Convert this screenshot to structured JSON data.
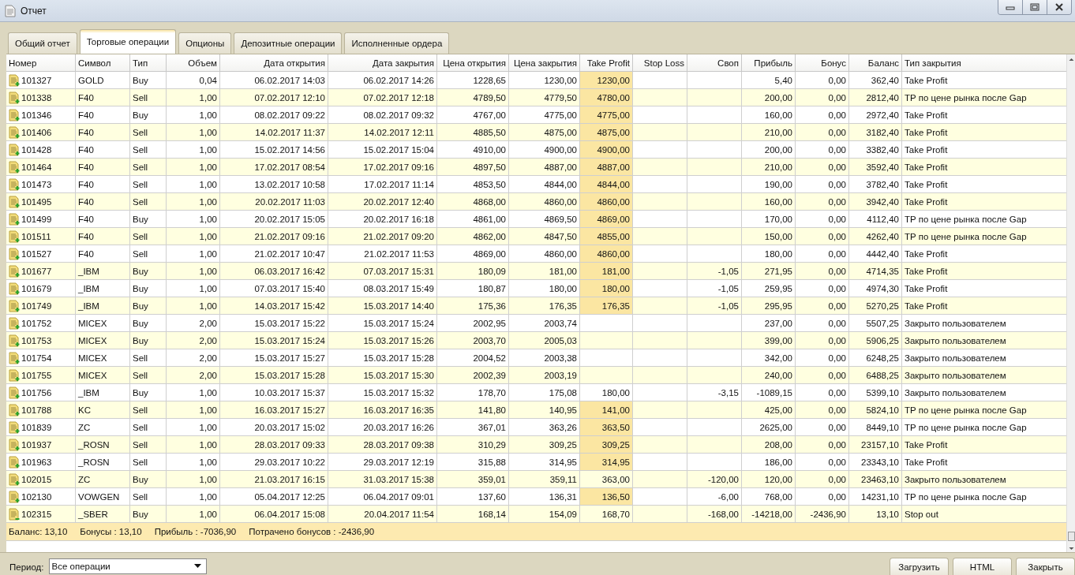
{
  "window": {
    "title": "Отчет"
  },
  "tabs": [
    {
      "label": "Общий отчет",
      "selected": false
    },
    {
      "label": "Торговые операции",
      "selected": true
    },
    {
      "label": "Опционы",
      "selected": false
    },
    {
      "label": "Депозитные операции",
      "selected": false
    },
    {
      "label": "Исполненные ордера",
      "selected": false
    }
  ],
  "table": {
    "columns": [
      "Номер",
      "Символ",
      "Тип",
      "Объем",
      "Дата открытия",
      "Дата закрытия",
      "Цена открытия",
      "Цена закрытия",
      "Take Profit",
      "Stop Loss",
      "Своп",
      "Прибыль",
      "Бонус",
      "Баланс",
      "Тип закрытия"
    ],
    "rows": [
      {
        "kind": "plus",
        "tp_hit": true,
        "cells": [
          "101327",
          "GOLD",
          "Buy",
          "0,04",
          "06.02.2017 14:03",
          "06.02.2017 14:26",
          "1228,65",
          "1230,00",
          "1230,00",
          null,
          null,
          "5,40",
          "0,00",
          "362,40",
          "Take Profit"
        ]
      },
      {
        "kind": "plus",
        "tp_hit": true,
        "cells": [
          "101338",
          "F40",
          "Sell",
          "1,00",
          "07.02.2017 12:10",
          "07.02.2017 12:18",
          "4789,50",
          "4779,50",
          "4780,00",
          null,
          null,
          "200,00",
          "0,00",
          "2812,40",
          "TP по цене рынка после Gap"
        ]
      },
      {
        "kind": "plus",
        "tp_hit": true,
        "cells": [
          "101346",
          "F40",
          "Buy",
          "1,00",
          "08.02.2017 09:22",
          "08.02.2017 09:32",
          "4767,00",
          "4775,00",
          "4775,00",
          null,
          null,
          "160,00",
          "0,00",
          "2972,40",
          "Take Profit"
        ]
      },
      {
        "kind": "plus",
        "tp_hit": true,
        "cells": [
          "101406",
          "F40",
          "Sell",
          "1,00",
          "14.02.2017 11:37",
          "14.02.2017 12:11",
          "4885,50",
          "4875,00",
          "4875,00",
          null,
          null,
          "210,00",
          "0,00",
          "3182,40",
          "Take Profit"
        ]
      },
      {
        "kind": "plus",
        "tp_hit": true,
        "cells": [
          "101428",
          "F40",
          "Sell",
          "1,00",
          "15.02.2017 14:56",
          "15.02.2017 15:04",
          "4910,00",
          "4900,00",
          "4900,00",
          null,
          null,
          "200,00",
          "0,00",
          "3382,40",
          "Take Profit"
        ]
      },
      {
        "kind": "plus",
        "tp_hit": true,
        "cells": [
          "101464",
          "F40",
          "Sell",
          "1,00",
          "17.02.2017 08:54",
          "17.02.2017 09:16",
          "4897,50",
          "4887,00",
          "4887,00",
          null,
          null,
          "210,00",
          "0,00",
          "3592,40",
          "Take Profit"
        ]
      },
      {
        "kind": "plus",
        "tp_hit": true,
        "cells": [
          "101473",
          "F40",
          "Sell",
          "1,00",
          "13.02.2017 10:58",
          "17.02.2017 11:14",
          "4853,50",
          "4844,00",
          "4844,00",
          null,
          null,
          "190,00",
          "0,00",
          "3782,40",
          "Take Profit"
        ]
      },
      {
        "kind": "plus",
        "tp_hit": true,
        "cells": [
          "101495",
          "F40",
          "Sell",
          "1,00",
          "20.02.2017 11:03",
          "20.02.2017 12:40",
          "4868,00",
          "4860,00",
          "4860,00",
          null,
          null,
          "160,00",
          "0,00",
          "3942,40",
          "Take Profit"
        ]
      },
      {
        "kind": "plus",
        "tp_hit": true,
        "cells": [
          "101499",
          "F40",
          "Buy",
          "1,00",
          "20.02.2017 15:05",
          "20.02.2017 16:18",
          "4861,00",
          "4869,50",
          "4869,00",
          null,
          null,
          "170,00",
          "0,00",
          "4112,40",
          "TP по цене рынка после Gap"
        ]
      },
      {
        "kind": "plus",
        "tp_hit": true,
        "cells": [
          "101511",
          "F40",
          "Sell",
          "1,00",
          "21.02.2017 09:16",
          "21.02.2017 09:20",
          "4862,00",
          "4847,50",
          "4855,00",
          null,
          null,
          "150,00",
          "0,00",
          "4262,40",
          "TP по цене рынка после Gap"
        ]
      },
      {
        "kind": "plus",
        "tp_hit": true,
        "cells": [
          "101527",
          "F40",
          "Sell",
          "1,00",
          "21.02.2017 10:47",
          "21.02.2017 11:53",
          "4869,00",
          "4860,00",
          "4860,00",
          null,
          null,
          "180,00",
          "0,00",
          "4442,40",
          "Take Profit"
        ]
      },
      {
        "kind": "plus",
        "tp_hit": true,
        "cells": [
          "101677",
          "_IBM",
          "Buy",
          "1,00",
          "06.03.2017 16:42",
          "07.03.2017 15:31",
          "180,09",
          "181,00",
          "181,00",
          null,
          "-1,05",
          "271,95",
          "0,00",
          "4714,35",
          "Take Profit"
        ]
      },
      {
        "kind": "plus",
        "tp_hit": true,
        "cells": [
          "101679",
          "_IBM",
          "Buy",
          "1,00",
          "07.03.2017 15:40",
          "08.03.2017 15:49",
          "180,87",
          "180,00",
          "180,00",
          null,
          "-1,05",
          "259,95",
          "0,00",
          "4974,30",
          "Take Profit"
        ]
      },
      {
        "kind": "plus",
        "tp_hit": true,
        "cells": [
          "101749",
          "_IBM",
          "Buy",
          "1,00",
          "14.03.2017 15:42",
          "15.03.2017 14:40",
          "175,36",
          "176,35",
          "176,35",
          null,
          "-1,05",
          "295,95",
          "0,00",
          "5270,25",
          "Take Profit"
        ]
      },
      {
        "kind": "plus",
        "tp_hit": false,
        "cells": [
          "101752",
          "MICEX",
          "Buy",
          "2,00",
          "15.03.2017 15:22",
          "15.03.2017 15:24",
          "2002,95",
          "2003,74",
          null,
          null,
          null,
          "237,00",
          "0,00",
          "5507,25",
          "Закрыто пользователем"
        ]
      },
      {
        "kind": "plus",
        "tp_hit": false,
        "cells": [
          "101753",
          "MICEX",
          "Buy",
          "2,00",
          "15.03.2017 15:24",
          "15.03.2017 15:26",
          "2003,70",
          "2005,03",
          null,
          null,
          null,
          "399,00",
          "0,00",
          "5906,25",
          "Закрыто пользователем"
        ]
      },
      {
        "kind": "plus",
        "tp_hit": false,
        "cells": [
          "101754",
          "MICEX",
          "Sell",
          "2,00",
          "15.03.2017 15:27",
          "15.03.2017 15:28",
          "2004,52",
          "2003,38",
          null,
          null,
          null,
          "342,00",
          "0,00",
          "6248,25",
          "Закрыто пользователем"
        ]
      },
      {
        "kind": "plus",
        "tp_hit": false,
        "cells": [
          "101755",
          "MICEX",
          "Sell",
          "2,00",
          "15.03.2017 15:28",
          "15.03.2017 15:30",
          "2002,39",
          "2003,19",
          null,
          null,
          null,
          "240,00",
          "0,00",
          "6488,25",
          "Закрыто пользователем"
        ]
      },
      {
        "kind": "plus",
        "tp_hit": false,
        "cells": [
          "101756",
          "_IBM",
          "Buy",
          "1,00",
          "10.03.2017 15:37",
          "15.03.2017 15:32",
          "178,70",
          "175,08",
          "180,00",
          null,
          "-3,15",
          "-1089,15",
          "0,00",
          "5399,10",
          "Закрыто пользователем"
        ]
      },
      {
        "kind": "plus",
        "tp_hit": true,
        "cells": [
          "101788",
          "KC",
          "Sell",
          "1,00",
          "16.03.2017 15:27",
          "16.03.2017 16:35",
          "141,80",
          "140,95",
          "141,00",
          null,
          null,
          "425,00",
          "0,00",
          "5824,10",
          "TP по цене рынка после Gap"
        ]
      },
      {
        "kind": "plus",
        "tp_hit": true,
        "cells": [
          "101839",
          "ZC",
          "Sell",
          "1,00",
          "20.03.2017 15:02",
          "20.03.2017 16:26",
          "367,01",
          "363,26",
          "363,50",
          null,
          null,
          "2625,00",
          "0,00",
          "8449,10",
          "TP по цене рынка после Gap"
        ]
      },
      {
        "kind": "plus",
        "tp_hit": true,
        "cells": [
          "101937",
          "_ROSN",
          "Sell",
          "1,00",
          "28.03.2017 09:33",
          "28.03.2017 09:38",
          "310,29",
          "309,25",
          "309,25",
          null,
          null,
          "208,00",
          "0,00",
          "23157,10",
          "Take Profit"
        ]
      },
      {
        "kind": "plus",
        "tp_hit": true,
        "cells": [
          "101963",
          "_ROSN",
          "Sell",
          "1,00",
          "29.03.2017 10:22",
          "29.03.2017 12:19",
          "315,88",
          "314,95",
          "314,95",
          null,
          null,
          "186,00",
          "0,00",
          "23343,10",
          "Take Profit"
        ]
      },
      {
        "kind": "plus",
        "tp_hit": false,
        "cells": [
          "102015",
          "ZC",
          "Buy",
          "1,00",
          "21.03.2017 16:15",
          "31.03.2017 15:38",
          "359,01",
          "359,11",
          "363,00",
          null,
          "-120,00",
          "120,00",
          "0,00",
          "23463,10",
          "Закрыто пользователем"
        ]
      },
      {
        "kind": "plus",
        "tp_hit": true,
        "cells": [
          "102130",
          "VOWGEN",
          "Sell",
          "1,00",
          "05.04.2017 12:25",
          "06.04.2017 09:01",
          "137,60",
          "136,31",
          "136,50",
          null,
          "-6,00",
          "768,00",
          "0,00",
          "14231,10",
          "TP по цене рынка после Gap"
        ]
      },
      {
        "kind": "minus",
        "tp_hit": false,
        "cells": [
          "102315",
          "_SBER",
          "Buy",
          "1,00",
          "06.04.2017 15:08",
          "20.04.2017 11:54",
          "168,14",
          "154,09",
          "168,70",
          null,
          "-168,00",
          "-14218,00",
          "-2436,90",
          "13,10",
          "Stop out"
        ]
      }
    ]
  },
  "summary": [
    "Баланс: 13,10",
    "Бонусы : 13,10",
    "Прибыль : -7036,90",
    "Потрачено бонусов : -2436,90"
  ],
  "period": {
    "label": "Период:",
    "value": "Все операции"
  },
  "buttons": [
    "Загрузить",
    "HTML",
    "Закрыть"
  ]
}
